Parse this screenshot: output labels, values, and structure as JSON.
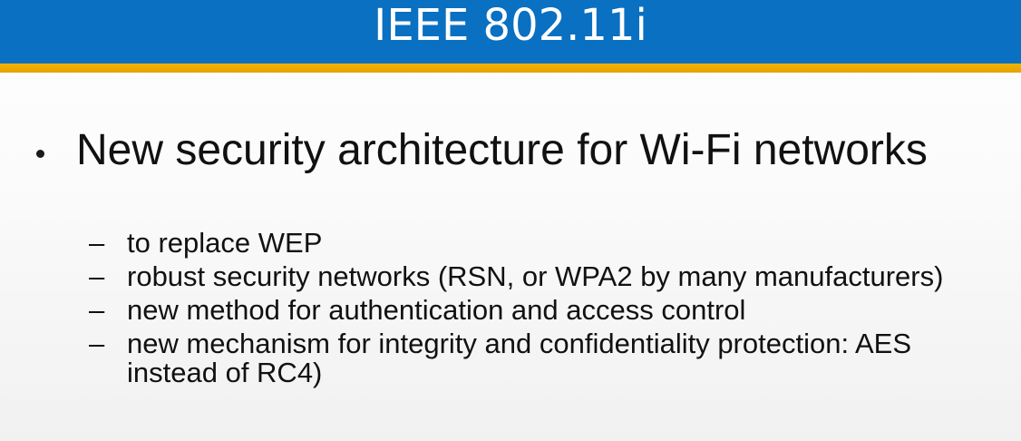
{
  "slide": {
    "title": "IEEE 802.11i",
    "bullet": {
      "text": "New security architecture for Wi-Fi networks",
      "subitems": [
        "to replace WEP",
        "robust security networks (RSN,  or WPA2 by many manufacturers)",
        "new method for authentication and access control",
        "new mechanism for integrity and confidentiality protection: AES instead of RC4)"
      ],
      "sub_marker": "–"
    }
  },
  "colors": {
    "title_bar": "#0a70c2",
    "accent_line": "#f0b400",
    "text": "#111111"
  }
}
